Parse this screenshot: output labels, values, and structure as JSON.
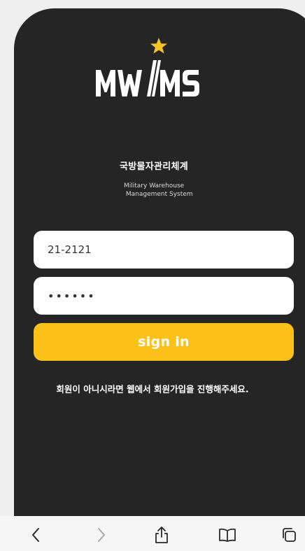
{
  "app": {
    "logo_text": "MWMS",
    "title": "국방물자관리체계",
    "subtitle": "Military Warehouse\n Management System"
  },
  "login": {
    "id_value": "21-2121",
    "password_value": "••••••",
    "signin_label": "sign in",
    "notice": "회원이 아니시라면 웹에서 회원가입을 진행해주세요."
  },
  "colors": {
    "background": "#252525",
    "accent": "#fcc21a",
    "star": "#f5c227"
  },
  "toolbar": {
    "items": [
      "back-icon",
      "forward-icon",
      "share-icon",
      "bookmarks-icon",
      "tabs-icon"
    ]
  }
}
